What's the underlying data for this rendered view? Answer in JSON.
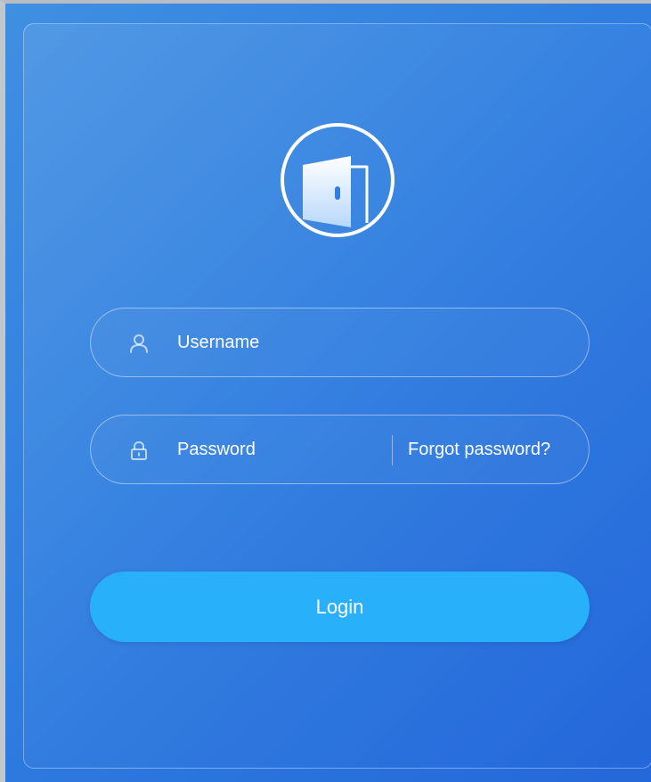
{
  "login_form": {
    "logo_icon": "door-icon",
    "username": {
      "icon": "user-icon",
      "placeholder": "Username",
      "value": ""
    },
    "password": {
      "icon": "lock-icon",
      "placeholder": "Password",
      "value": "",
      "forgot_label": "Forgot password?"
    },
    "login_label": "Login"
  },
  "colors": {
    "background_start": "#3f8fe2",
    "background_end": "#2467da",
    "login_button": "#29b0fb",
    "text": "#ffffff"
  }
}
